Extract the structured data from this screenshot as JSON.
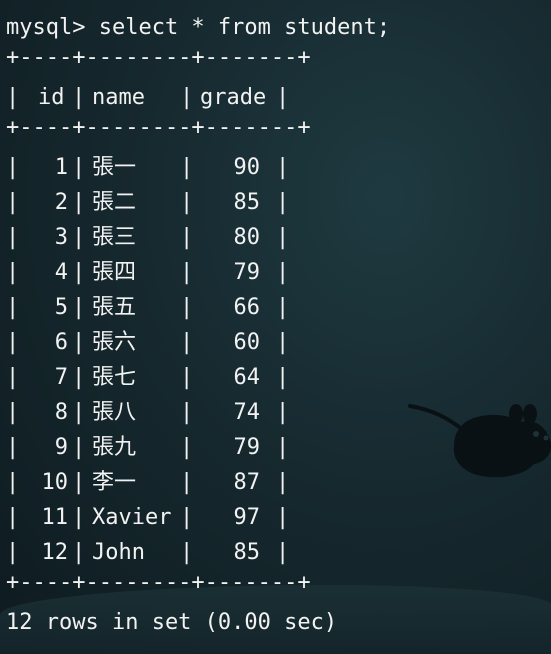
{
  "terminal": {
    "prompt_line": "mysql> select * from student;",
    "border": "+----+--------+-------+",
    "header": {
      "id": "id",
      "name": "name",
      "grade": "grade"
    },
    "rows": [
      {
        "id": "1",
        "name": "張一",
        "grade": "90"
      },
      {
        "id": "2",
        "name": "張二",
        "grade": "85"
      },
      {
        "id": "3",
        "name": "張三",
        "grade": "80"
      },
      {
        "id": "4",
        "name": "張四",
        "grade": "79"
      },
      {
        "id": "5",
        "name": "張五",
        "grade": "66"
      },
      {
        "id": "6",
        "name": "張六",
        "grade": "60"
      },
      {
        "id": "7",
        "name": "張七",
        "grade": "64"
      },
      {
        "id": "8",
        "name": "張八",
        "grade": "74"
      },
      {
        "id": "9",
        "name": "張九",
        "grade": "79"
      },
      {
        "id": "10",
        "name": "李一",
        "grade": "87"
      },
      {
        "id": "11",
        "name": "Xavier",
        "grade": "97"
      },
      {
        "id": "12",
        "name": "John",
        "grade": "85"
      }
    ],
    "footer": "12 rows in set (0.00 sec)"
  },
  "background": {
    "base_color": "#16292f",
    "mouse_icon": "xfce-mouse-icon"
  }
}
